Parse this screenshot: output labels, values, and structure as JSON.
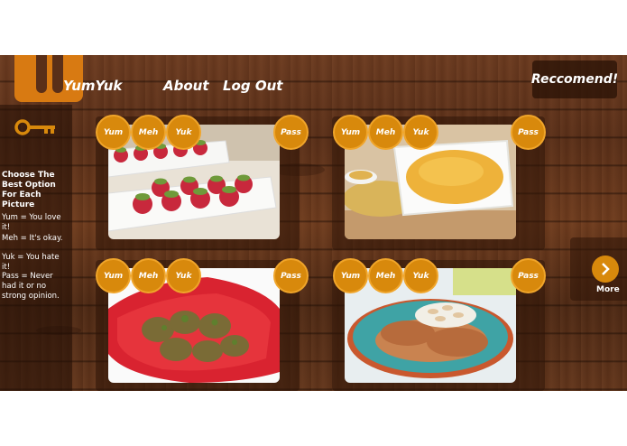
{
  "header": {
    "brand": "YumYuk",
    "nav": {
      "about": "About",
      "logout": "Log Out"
    },
    "recommend_label": "Reccomend!"
  },
  "sidebar": {
    "heading": "Choose The Best Option For Each Picture",
    "legend": {
      "yum": "Yum = You love it!",
      "meh": "Meh = It's okay.",
      "yuk": "Yuk = You hate it!",
      "pass": "Pass = Never had it or no strong opinion."
    }
  },
  "rating_labels": {
    "yum": "Yum",
    "meh": "Meh",
    "yuk": "Yuk",
    "pass": "Pass"
  },
  "cards": [
    {
      "food": "tomato-appetizers"
    },
    {
      "food": "hummus-dip"
    },
    {
      "food": "fried-okra"
    },
    {
      "food": "almond-chicken"
    }
  ],
  "more_label": "More",
  "colors": {
    "accent": "#d8890c",
    "wood": "#5a2f18",
    "text": "#ffffff"
  }
}
